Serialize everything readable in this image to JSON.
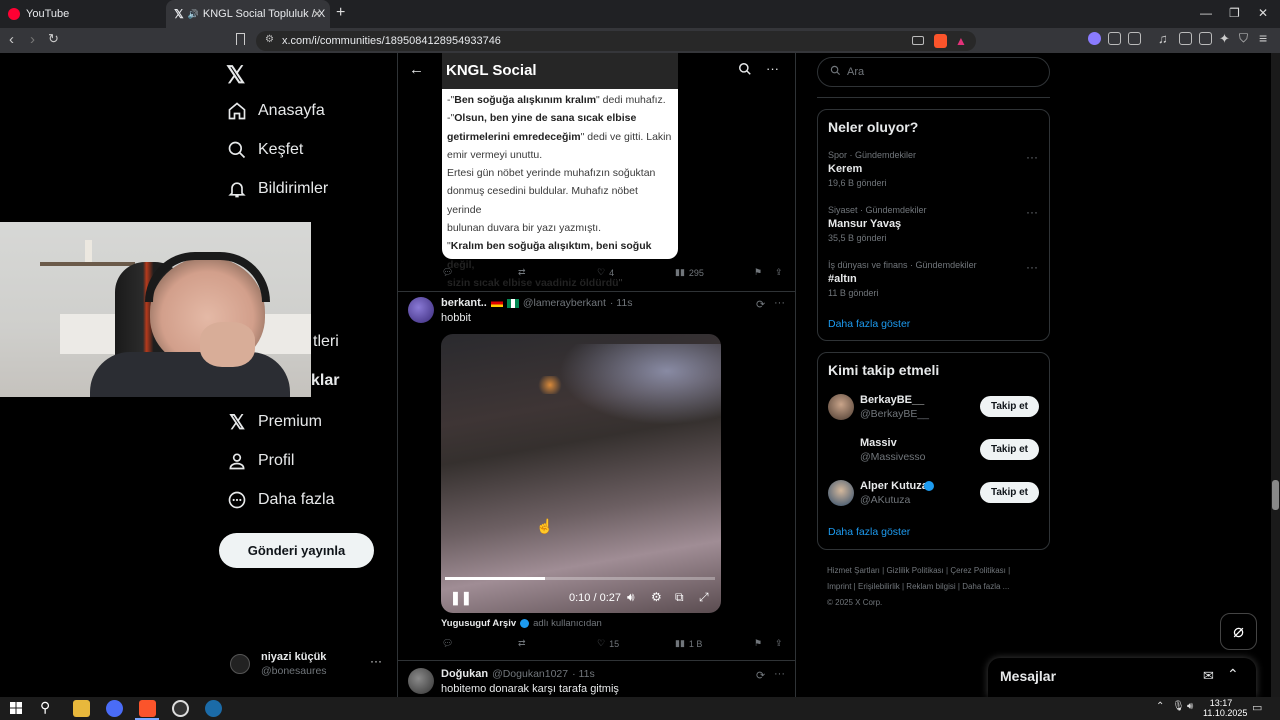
{
  "browser": {
    "tabs": [
      {
        "title": "YouTube"
      },
      {
        "title": "KNGL Social Topluluk / X"
      }
    ],
    "url": "x.com/i/communities/1895084128954933746"
  },
  "left_nav": {
    "items": [
      {
        "label": "Anasayfa"
      },
      {
        "label": "Keşfet"
      },
      {
        "label": "Bildirimler"
      },
      {
        "label": "tleri"
      },
      {
        "label": "klar"
      },
      {
        "label": "Premium"
      },
      {
        "label": "Profil"
      },
      {
        "label": "Daha fazla"
      }
    ],
    "post_button": "Gönderi yayınla",
    "account": {
      "name": "niyazi küçük",
      "handle": "@bonesaures"
    }
  },
  "header": {
    "title": "KNGL Social"
  },
  "post1": {
    "image_lines": [
      {
        "pre": "-\"",
        "bold": "Ben soğuğa alışkınım kralım",
        "post": "\" dedi muhafız."
      },
      {
        "pre": "-\"",
        "bold": "Olsun, ben yine de sana sıcak elbise",
        "post": ""
      },
      {
        "pre": "",
        "bold": "getirmelerini emredeceğim",
        "post": "\" dedi ve gitti. Lakin"
      },
      {
        "pre": "emir vermeyi unuttu.",
        "bold": "",
        "post": ""
      },
      {
        "pre": "Ertesi gün nöbet yerinde muhafızın soğuktan",
        "bold": "",
        "post": ""
      },
      {
        "pre": "donmuş cesedini buldular. Muhafız nöbet yerinde",
        "bold": "",
        "post": ""
      },
      {
        "pre": "bulunan duvara bir yazı yazmıştı.",
        "bold": "",
        "post": ""
      },
      {
        "pre": "\"",
        "bold": "Kralım ben soğuğa alışıktım, beni soğuk değil,",
        "post": ""
      },
      {
        "pre": "",
        "bold": "sizin sıcak elbise vaadiniz öldürdü",
        "post": "\""
      }
    ],
    "likes": "4",
    "views": "295"
  },
  "post2": {
    "name": "berkant..",
    "handle": "@lamerayberkant",
    "time": "· 11s",
    "text": "hobbit",
    "video_time": "0:10 / 0:27",
    "video_progress": 0.37,
    "attribution_name": "Yugusuguf Arşiv",
    "attribution_suffix": "adlı kullanıcıdan",
    "likes": "15",
    "views": "1 B"
  },
  "post3": {
    "name": "Doğukan",
    "handle": "@Dogukan1027",
    "time": "· 11s",
    "text": "hobitemo donarak karşı tarafa gitmiş"
  },
  "search": {
    "placeholder": "Ara"
  },
  "trends": {
    "title": "Neler oluyor?",
    "items": [
      {
        "meta": "Spor · Gündemdekiler",
        "name": "Kerem",
        "count": "19,6 B gönderi"
      },
      {
        "meta": "Siyaset · Gündemdekiler",
        "name": "Mansur Yavaş",
        "count": "35,5 B gönderi"
      },
      {
        "meta": "İş dünyası ve finans · Gündemdekiler",
        "name": "#altın",
        "count": "11 B gönderi"
      }
    ],
    "show_more": "Daha fazla göster"
  },
  "who_to_follow": {
    "title": "Kimi takip etmeli",
    "users": [
      {
        "name": "BerkayBE__",
        "handle": "@BerkayBE__",
        "button": "Takip et"
      },
      {
        "name": "Massiv",
        "handle": "@Massivesso",
        "button": "Takip et"
      },
      {
        "name": "Alper Kutuza",
        "handle": "@AKutuza",
        "button": "Takip et"
      }
    ],
    "show_more": "Daha fazla göster"
  },
  "footer": {
    "links1": [
      "Hizmet Şartları",
      "Gizlilik Politikası",
      "Çerez Politikası"
    ],
    "links2": [
      "Imprint",
      "Erişilebilirlik",
      "Reklam bilgisi",
      "Daha fazla ..."
    ],
    "copyright": "© 2025 X Corp."
  },
  "messages": {
    "title": "Mesajlar"
  },
  "taskbar": {
    "time": "13:17",
    "date": "11.10.2025"
  },
  "colors": {
    "accent": "#1d9bf0",
    "background": "#000000",
    "border": "#2f3336",
    "muted": "#71767b"
  }
}
